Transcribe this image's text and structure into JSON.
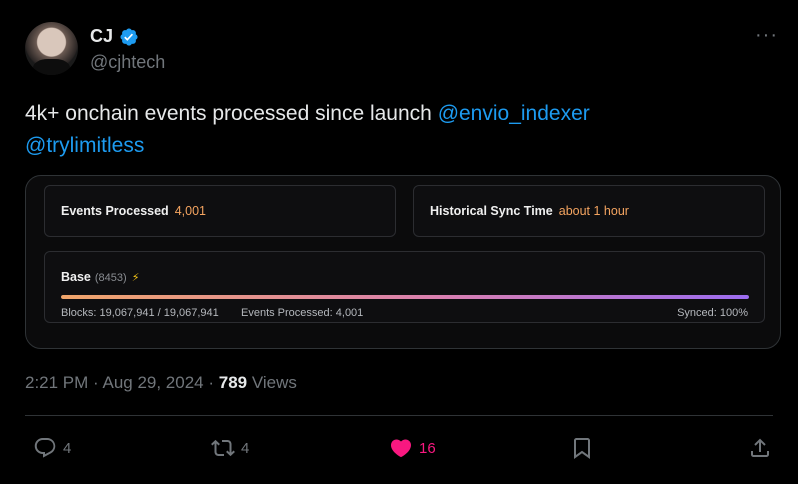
{
  "author": {
    "name": "CJ",
    "handle": "@cjhtech"
  },
  "tweet": {
    "text_main": "4k+ onchain events processed since launch ",
    "mention_1": "@envio_indexer",
    "mention_2": "@trylimitless"
  },
  "card": {
    "events_label": "Events Processed",
    "events_value": "4,001",
    "sync_label": "Historical Sync Time",
    "sync_value": "about 1 hour",
    "chain_name": "Base",
    "chain_id": "(8453)",
    "chain_bolt": "⚡",
    "progress": 1.0,
    "blocks_text": "Blocks: 19,067,941 / 19,067,941",
    "events_text": "Events Processed: 4,001",
    "synced_text": "Synced: 100%"
  },
  "meta": {
    "time": "2:21 PM",
    "sep1": " · ",
    "date": "Aug 29, 2024",
    "sep2": " · ",
    "views_count": "789",
    "views_label": " Views"
  },
  "actions": {
    "replies": "4",
    "retweets": "4",
    "likes": "16"
  },
  "colors": {
    "accent": "#1d9bf0",
    "like": "#f91880",
    "value_orange": "#f4a460"
  },
  "icons": {
    "verified": "verified-badge-icon",
    "more": "more-horizontal-icon",
    "reply": "reply-icon",
    "retweet": "retweet-icon",
    "like": "heart-filled-icon",
    "bookmark": "bookmark-icon",
    "share": "share-icon"
  }
}
